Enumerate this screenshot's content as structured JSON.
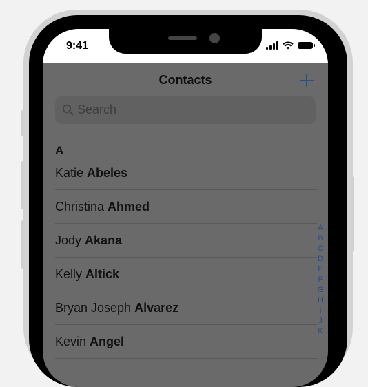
{
  "status_bar": {
    "time": "9:41"
  },
  "nav": {
    "title": "Contacts",
    "add_label": "+"
  },
  "search": {
    "placeholder": "Search"
  },
  "section": {
    "letter": "A"
  },
  "contacts": [
    {
      "first": "Katie",
      "last": "Abeles"
    },
    {
      "first": "Christina",
      "last": "Ahmed"
    },
    {
      "first": "Jody",
      "last": "Akana"
    },
    {
      "first": "Kelly",
      "last": "Altick"
    },
    {
      "first": "Bryan Joseph",
      "last": "Alvarez"
    },
    {
      "first": "Kevin",
      "last": "Angel"
    }
  ],
  "index_letters": [
    "A",
    "B",
    "C",
    "D",
    "E",
    "F",
    "G",
    "H",
    "I",
    "J",
    "K"
  ],
  "colors": {
    "accent": "#1f4f96",
    "dim_overlay": "#6a6a6a"
  },
  "icons": [
    "signal-icon",
    "wifi-icon",
    "battery-icon",
    "search-icon",
    "plus-icon"
  ]
}
